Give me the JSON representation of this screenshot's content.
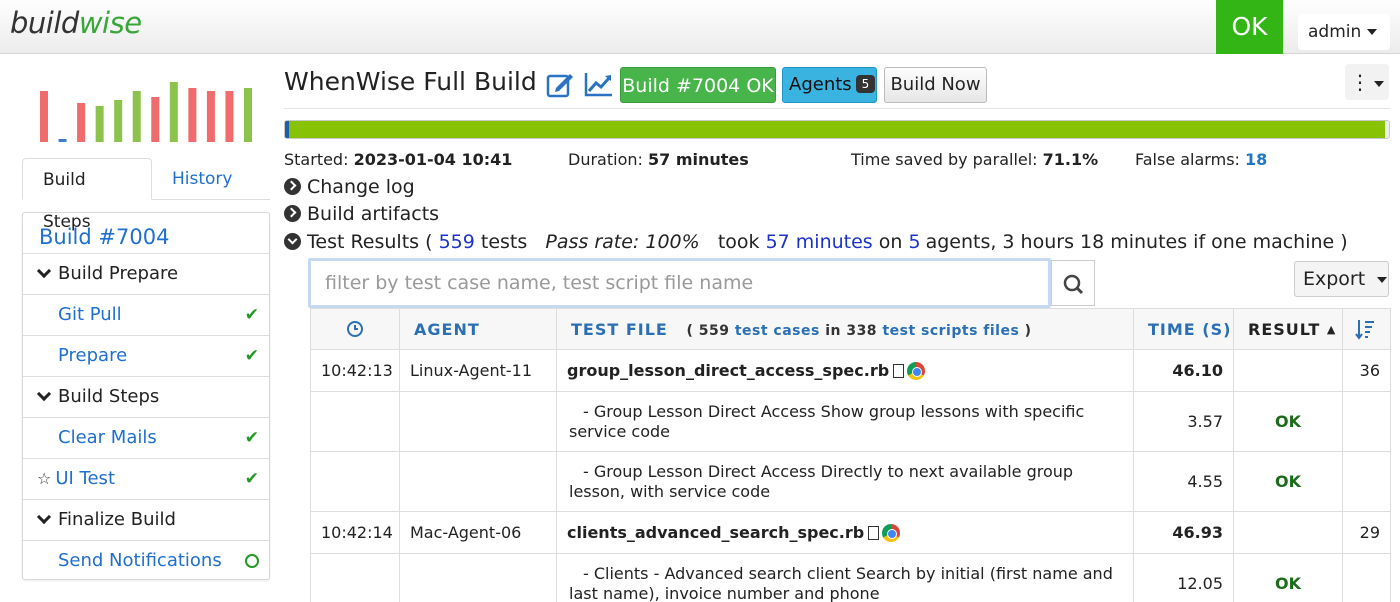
{
  "brand": {
    "part1": "build",
    "part2": "wise"
  },
  "top": {
    "status": "OK",
    "user": "admin"
  },
  "mini_chart": {
    "values": [
      0.85,
      0.05,
      0.65,
      0.6,
      0.7,
      0.85,
      0.75,
      1.0,
      0.9,
      0.85,
      0.85,
      0.9
    ],
    "colors": [
      "#f06b6b",
      "#3c7fd0",
      "#f06b6b",
      "#8cc34a",
      "#8cc34a",
      "#8cc34a",
      "#f06b6b",
      "#8cc34a",
      "#f06b6b",
      "#f06b6b",
      "#f06b6b",
      "#8cc34a"
    ]
  },
  "tabs": {
    "build_steps": "Build Steps",
    "history": "History"
  },
  "steps": {
    "title": "Build #7004",
    "groups": [
      {
        "label": "Build Prepare",
        "items": [
          {
            "label": "Git Pull",
            "status": "✔"
          },
          {
            "label": "Prepare",
            "status": "✔"
          }
        ]
      },
      {
        "label": "Build Steps",
        "items": [
          {
            "label": "Clear Mails",
            "status": "✔"
          },
          {
            "label": "UI Test",
            "status": "✔"
          }
        ]
      },
      {
        "label": "Finalize Build",
        "items": [
          {
            "label": "Send Notifications",
            "status": ""
          }
        ]
      }
    ]
  },
  "header": {
    "title": "WhenWise Full Build",
    "badge": "Build #7004 OK",
    "agents_label": "Agents",
    "agents_count": "5",
    "build_now": "Build Now"
  },
  "progress": {
    "fraction": 0.996
  },
  "stats": {
    "started_label": "Started:",
    "started": "2023-01-04 10:41",
    "duration_label": "Duration:",
    "duration": "57 minutes",
    "saved_label": "Time saved by parallel:",
    "saved": "71.1%",
    "false_label": "False alarms:",
    "false_alarms": "18"
  },
  "sections": {
    "changelog": "Change log",
    "artifacts": "Build artifacts",
    "results_prefix": "Test Results (",
    "results_tests": "559",
    "results_tests_label": "tests",
    "pass_rate": "Pass rate: 100%",
    "took": "took",
    "took_time": "57 minutes",
    "on": "on",
    "agents_num": "5",
    "agents_suffix": "agents, 3 hours 18 minutes if one machine )"
  },
  "filter": {
    "placeholder": "filter by test case name, test script file name"
  },
  "export": {
    "label": "Export"
  },
  "table": {
    "headers": {
      "agent": "AGENT",
      "file": "TEST FILE",
      "file_sub_open": "( 559",
      "file_sub_cases": "test cases",
      "file_sub_in": "in 338",
      "file_sub_scripts": "test scripts files",
      "file_sub_close": ")",
      "time": "TIME (S)",
      "result": "RESULT"
    },
    "rows": [
      {
        "time": "10:42:13",
        "agent": "Linux-Agent-11",
        "file": "group_lesson_direct_access_spec.rb",
        "secs": "46.10",
        "result": "",
        "order": "36"
      },
      {
        "time": "",
        "agent": "",
        "case": "- Group Lesson Direct Access Show group lessons with specific service code",
        "secs": "3.57",
        "result": "OK",
        "order": ""
      },
      {
        "time": "",
        "agent": "",
        "case": "- Group Lesson Direct Access Directly to next available group lesson, with service code",
        "secs": "4.55",
        "result": "OK",
        "order": ""
      },
      {
        "time": "10:42:14",
        "agent": "Mac-Agent-06",
        "file": "clients_advanced_search_spec.rb",
        "secs": "46.93",
        "result": "",
        "order": "29"
      },
      {
        "time": "",
        "agent": "",
        "case": "- Clients - Advanced search client Search by initial (first name and last name), invoice number and phone",
        "secs": "12.05",
        "result": "OK",
        "order": ""
      }
    ]
  }
}
